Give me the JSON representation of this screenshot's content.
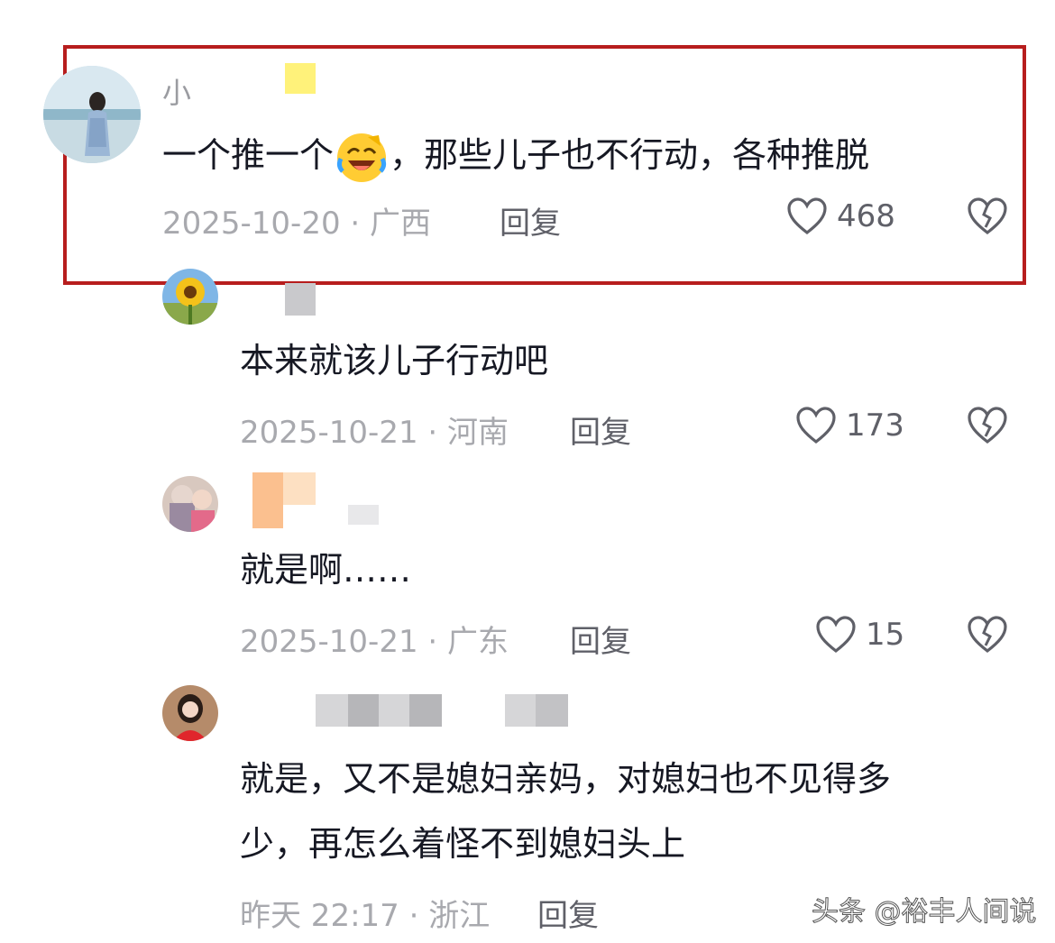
{
  "annotation": {
    "box_color": "#b71d1d"
  },
  "comments": [
    {
      "author_visible": "小",
      "text": "一个推一个",
      "text_after_emoji": "，那些儿子也不行动，各种推脱",
      "emoji": "face-with-tears-of-joy-icon",
      "date_location": "2025-10-20 · 广西",
      "reply_label": "回复",
      "likes": "468"
    },
    {
      "author_visible": "",
      "text": "本来就该儿子行动吧",
      "date_location": "2025-10-21 · 河南",
      "reply_label": "回复",
      "likes": "173"
    },
    {
      "author_visible": "",
      "text": "就是啊……",
      "date_location": "2025-10-21 · 广东",
      "reply_label": "回复",
      "likes": "15"
    },
    {
      "author_visible": "",
      "text_line1": "就是，又不是媳妇亲妈，对媳妇也不见得多",
      "text_line2": "少，再怎么着怪不到媳妇头上",
      "date_location": "昨天 22:17 · 浙江",
      "reply_label": "回复"
    }
  ],
  "watermark": "头条 @裕丰人间说"
}
